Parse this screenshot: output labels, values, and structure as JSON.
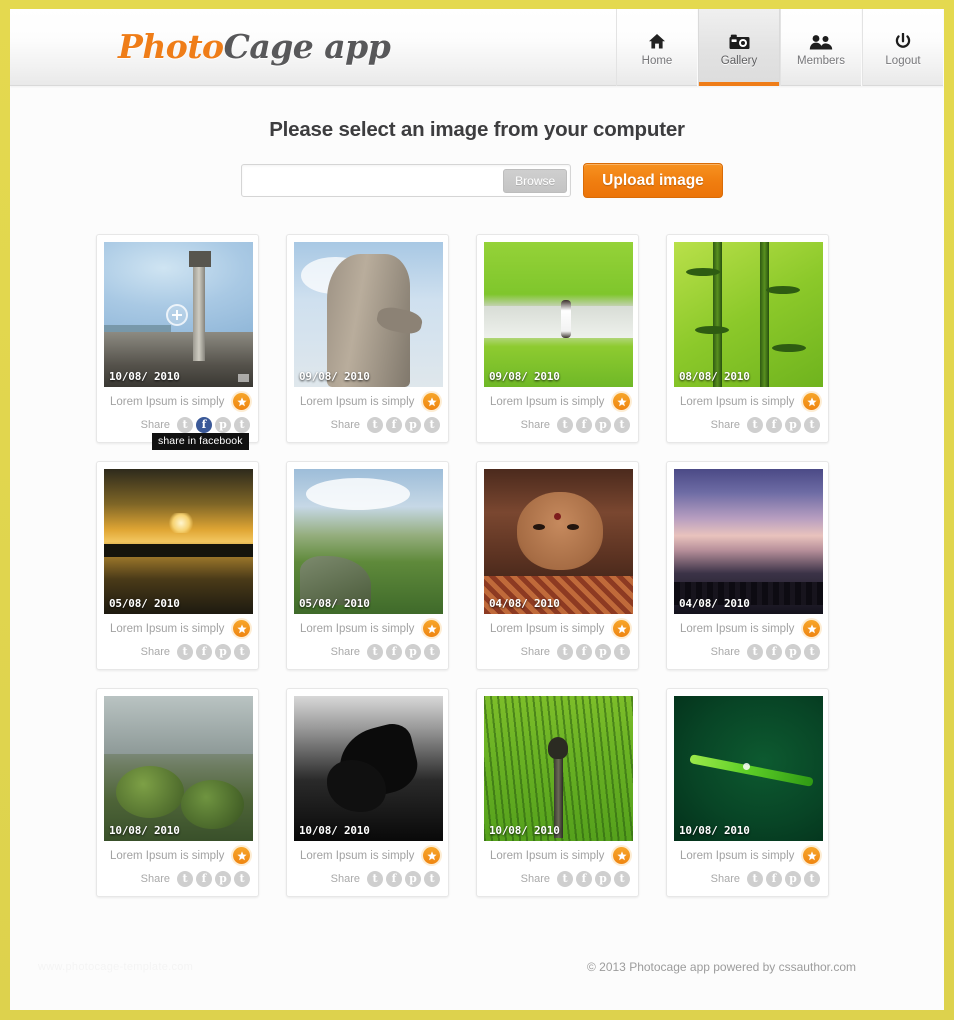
{
  "header": {
    "logo": {
      "part1": "Photo",
      "part2": "Cage",
      "part3": " app"
    },
    "nav": [
      {
        "label": "Home",
        "icon": "home-icon",
        "active": false
      },
      {
        "label": "Gallery",
        "icon": "camera-icon",
        "active": true
      },
      {
        "label": "Members",
        "icon": "users-icon",
        "active": false
      },
      {
        "label": "Logout",
        "icon": "power-icon",
        "active": false
      }
    ]
  },
  "upload": {
    "title": "Please select an image from your computer",
    "file_value": "",
    "file_placeholder": "",
    "browse_label": "Browse",
    "submit_label": "Upload image"
  },
  "gallery": {
    "share_label": "Share",
    "tooltip": "share in facebook",
    "share_icons": [
      "t",
      "f",
      "p",
      "t"
    ],
    "photos": [
      {
        "date": "10/08/ 2010",
        "caption": "Lorem Ipsum is simply",
        "scene": "s-pillar",
        "zoom_overlay": true,
        "tooltip": true,
        "fb_active": true,
        "badge": true
      },
      {
        "date": "09/08/ 2010",
        "caption": "Lorem Ipsum is simply",
        "scene": "s-statue",
        "zoom_overlay": false,
        "tooltip": false,
        "fb_active": false,
        "badge": false
      },
      {
        "date": "09/08/ 2010",
        "caption": "Lorem Ipsum is simply",
        "scene": "s-field",
        "zoom_overlay": false,
        "tooltip": false,
        "fb_active": false,
        "badge": false
      },
      {
        "date": "08/08/ 2010",
        "caption": "Lorem Ipsum is simply",
        "scene": "s-bamboo",
        "zoom_overlay": false,
        "tooltip": false,
        "fb_active": false,
        "badge": false
      },
      {
        "date": "05/08/ 2010",
        "caption": "Lorem Ipsum is simply",
        "scene": "s-sunset",
        "zoom_overlay": false,
        "tooltip": false,
        "fb_active": false,
        "badge": false
      },
      {
        "date": "05/08/ 2010",
        "caption": "Lorem Ipsum is simply",
        "scene": "s-hills",
        "zoom_overlay": false,
        "tooltip": false,
        "fb_active": false,
        "badge": false
      },
      {
        "date": "04/08/ 2010",
        "caption": "Lorem Ipsum is simply",
        "scene": "s-child",
        "zoom_overlay": false,
        "tooltip": false,
        "fb_active": false,
        "badge": false
      },
      {
        "date": "04/08/ 2010",
        "caption": "Lorem Ipsum is simply",
        "scene": "s-dusk",
        "zoom_overlay": false,
        "tooltip": false,
        "fb_active": false,
        "badge": false
      },
      {
        "date": "10/08/ 2010",
        "caption": "Lorem Ipsum is simply",
        "scene": "s-moss",
        "zoom_overlay": false,
        "tooltip": false,
        "fb_active": false,
        "badge": false
      },
      {
        "date": "10/08/ 2010",
        "caption": "Lorem Ipsum is simply",
        "scene": "s-butterfly",
        "zoom_overlay": false,
        "tooltip": false,
        "fb_active": false,
        "badge": false
      },
      {
        "date": "10/08/ 2010",
        "caption": "Lorem Ipsum is simply",
        "scene": "s-bird",
        "zoom_overlay": false,
        "tooltip": false,
        "fb_active": false,
        "badge": false
      },
      {
        "date": "10/08/ 2010",
        "caption": "Lorem Ipsum is simply",
        "scene": "s-leaf",
        "zoom_overlay": false,
        "tooltip": false,
        "fb_active": false,
        "badge": false
      }
    ]
  },
  "footer": {
    "watermark": "www.photocage-template.com",
    "credit": "© 2013 Photocage app  powered by cssauthor.com"
  },
  "colors": {
    "accent_orange": "#ef7d18",
    "page_border_gold": "#ddd24d",
    "facebook_blue": "#3b5998",
    "share_gray": "#cfcfcf"
  }
}
